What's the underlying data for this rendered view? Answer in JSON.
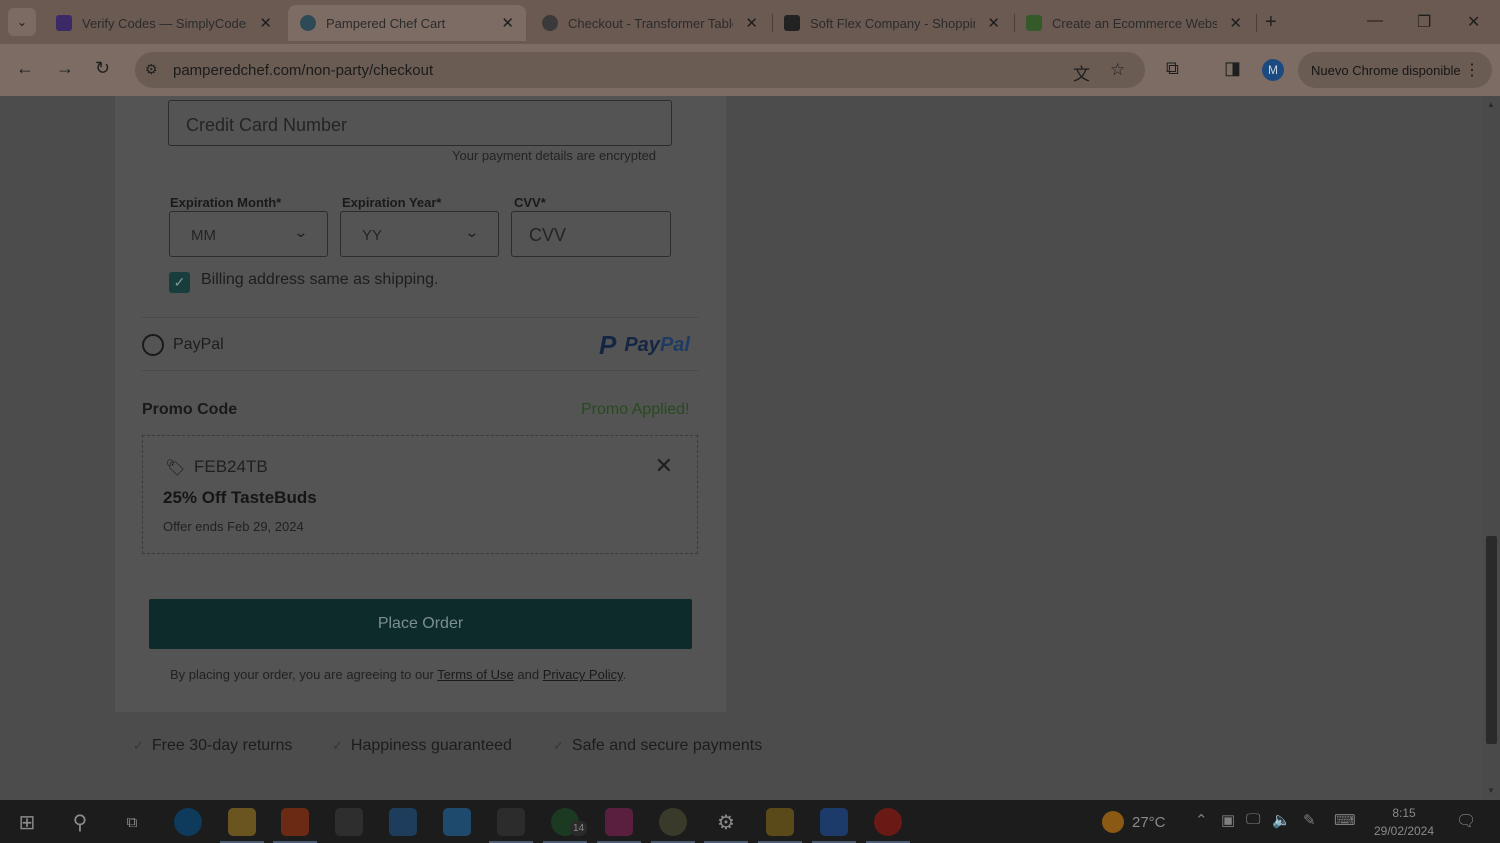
{
  "browser": {
    "tabs": [
      {
        "title": "Verify Codes — SimplyCodes",
        "favicon": "simplycodes-icon",
        "color": "#3c2a66",
        "active": false
      },
      {
        "title": "Pampered Chef Cart",
        "favicon": "pampered-chef-icon",
        "color": "#2f4a57",
        "active": true
      },
      {
        "title": "Checkout - Transformer Table",
        "favicon": "globe-icon",
        "color": "#3a3a3a",
        "active": false
      },
      {
        "title": "Soft Flex Company - Shopping",
        "favicon": "softflex-icon",
        "color": "#222222",
        "active": false
      },
      {
        "title": "Create an Ecommerce Website",
        "favicon": "shopify-icon",
        "color": "#355a2a",
        "active": false
      }
    ],
    "url": "pamperedchef.com/non-party/checkout",
    "profile_initial": "M",
    "update_label": "Nuevo Chrome disponible"
  },
  "payment": {
    "card_number_placeholder": "Credit Card Number",
    "encrypted_note": "Your payment details are encrypted",
    "exp_month_label": "Expiration Month*",
    "exp_month_value": "MM",
    "exp_year_label": "Expiration Year*",
    "exp_year_value": "YY",
    "cvv_label": "CVV*",
    "cvv_placeholder": "CVV",
    "billing_same_label": "Billing address same as shipping.",
    "billing_same_checked": true,
    "paypal_label": "PayPal",
    "paypal_logo_text_1": "Pay",
    "paypal_logo_text_2": "Pal"
  },
  "promo": {
    "title": "Promo Code",
    "status": "Promo Applied!",
    "code": "FEB24TB",
    "name": "25% Off TasteBuds",
    "expires": "Offer ends Feb 29, 2024"
  },
  "order": {
    "button_label": "Place Order",
    "legal_prefix": "By placing your order, you are agreeing to our",
    "terms_link": "Terms of Use",
    "and": "and",
    "privacy_link": "Privacy Policy",
    "period": "."
  },
  "features": [
    {
      "label": "Free 30-day returns"
    },
    {
      "label": "Happiness guaranteed"
    },
    {
      "label": "Safe and secure payments"
    }
  ],
  "taskbar": {
    "whatsapp_badge": "14",
    "temperature": "27°C",
    "time": "8:15",
    "date": "29/02/2024"
  }
}
